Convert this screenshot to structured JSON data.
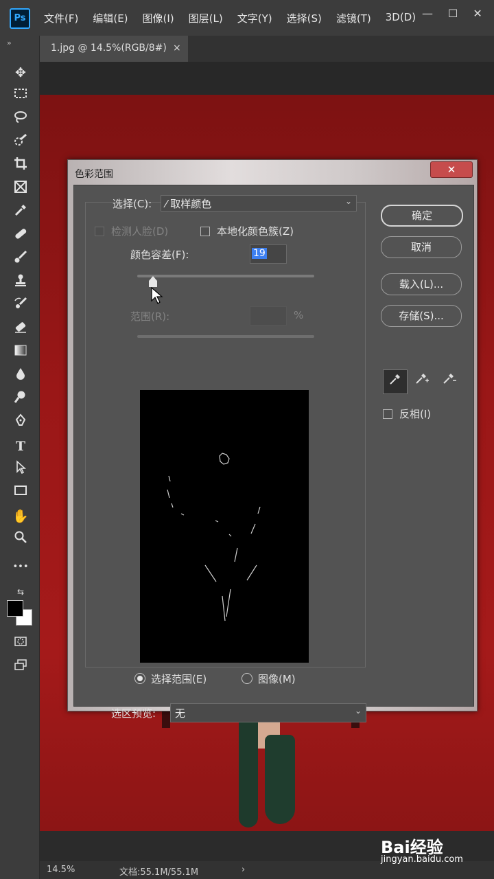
{
  "app": {
    "logo": "Ps"
  },
  "menu": {
    "items": [
      "文件(F)",
      "编辑(E)",
      "图像(I)",
      "图层(L)",
      "文字(Y)",
      "选择(S)",
      "滤镜(T)",
      "3D(D)"
    ]
  },
  "window": {
    "minimize": "—",
    "maximize": "☐",
    "close": "✕"
  },
  "doc_tab": {
    "title": "1.jpg @ 14.5%(RGB/8#)",
    "close": "×"
  },
  "toolbar": {
    "collapse": "»",
    "more": "•••"
  },
  "dialog": {
    "title": "色彩范围",
    "close": "✕",
    "select_label": "选择(C):",
    "select_value": "取样颜色",
    "detect_faces": "检测人脸(D)",
    "localized": "本地化颜色簇(Z)",
    "fuzziness_label": "颜色容差(F):",
    "fuzziness_value": "19",
    "fuzziness_level": 0.09,
    "range_label": "范围(R):",
    "range_unit": "%",
    "radio_selection": "选择范围(E)",
    "radio_image": "图像(M)",
    "preview_label": "选区预览:",
    "preview_value": "无",
    "ok": "确定",
    "cancel": "取消",
    "load": "载入(L)...",
    "save": "存储(S)...",
    "invert": "反相(I)"
  },
  "status": {
    "zoom": "14.5%",
    "doc": "文档:55.1M/55.1M",
    "arrow": "›"
  },
  "watermark": {
    "brand": "Bai经验",
    "url": "jingyan.baidu.com"
  },
  "colors": {
    "accent": "#31a8ff",
    "selection": "#3d7ff0",
    "close_red": "#c64c4c",
    "backdrop": "#9a1717"
  }
}
